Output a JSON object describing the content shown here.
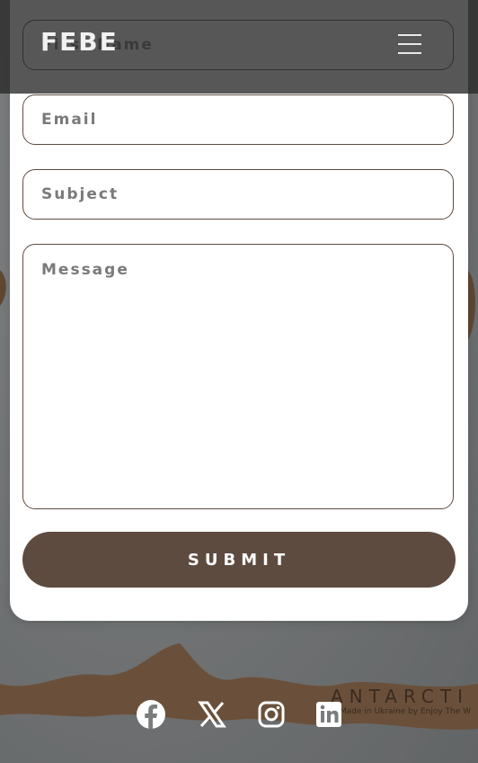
{
  "header": {
    "logo": "FEBE"
  },
  "form": {
    "first_name_placeholder": "First Name",
    "email_placeholder": "Email",
    "subject_placeholder": "Subject",
    "message_placeholder": "Message",
    "submit_label": "SUBMIT"
  },
  "background": {
    "map_label": "ANTARCTI",
    "map_sublabel": "Made in Ukraine by Enjoy The W"
  },
  "social": {
    "icons": [
      "facebook-icon",
      "x-twitter-icon",
      "instagram-icon",
      "linkedin-icon"
    ]
  },
  "colors": {
    "accent": "#5e4b40",
    "card": "#ffffff",
    "header": "#282828"
  }
}
